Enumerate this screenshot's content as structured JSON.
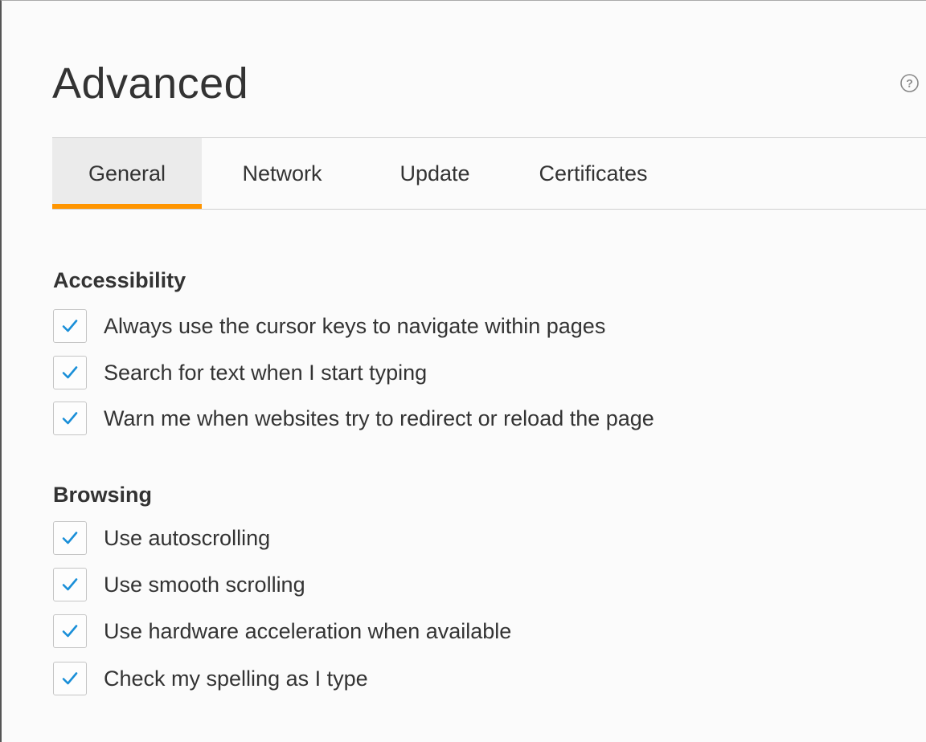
{
  "page": {
    "title": "Advanced",
    "help_icon": "question-circle-icon"
  },
  "tabs": [
    {
      "label": "General",
      "selected": true
    },
    {
      "label": "Network",
      "selected": false
    },
    {
      "label": "Update",
      "selected": false
    },
    {
      "label": "Certificates",
      "selected": false
    }
  ],
  "accessibility": {
    "heading": "Accessibility",
    "options": [
      {
        "label": "Always use the cursor keys to navigate within pages",
        "checked": true
      },
      {
        "label": "Search for text when I start typing",
        "checked": true
      },
      {
        "label": "Warn me when websites try to redirect or reload the page",
        "checked": true
      }
    ]
  },
  "browsing": {
    "heading": "Browsing",
    "options": [
      {
        "label": "Use autoscrolling",
        "checked": true
      },
      {
        "label": "Use smooth scrolling",
        "checked": true
      },
      {
        "label": "Use hardware acceleration when available",
        "checked": true
      },
      {
        "label": "Check my spelling as I type",
        "checked": true
      }
    ]
  },
  "colors": {
    "accent_tab_underline": "#ff9500",
    "checkmark": "#1a8fd8",
    "selected_tab_bg": "#ebebeb"
  }
}
